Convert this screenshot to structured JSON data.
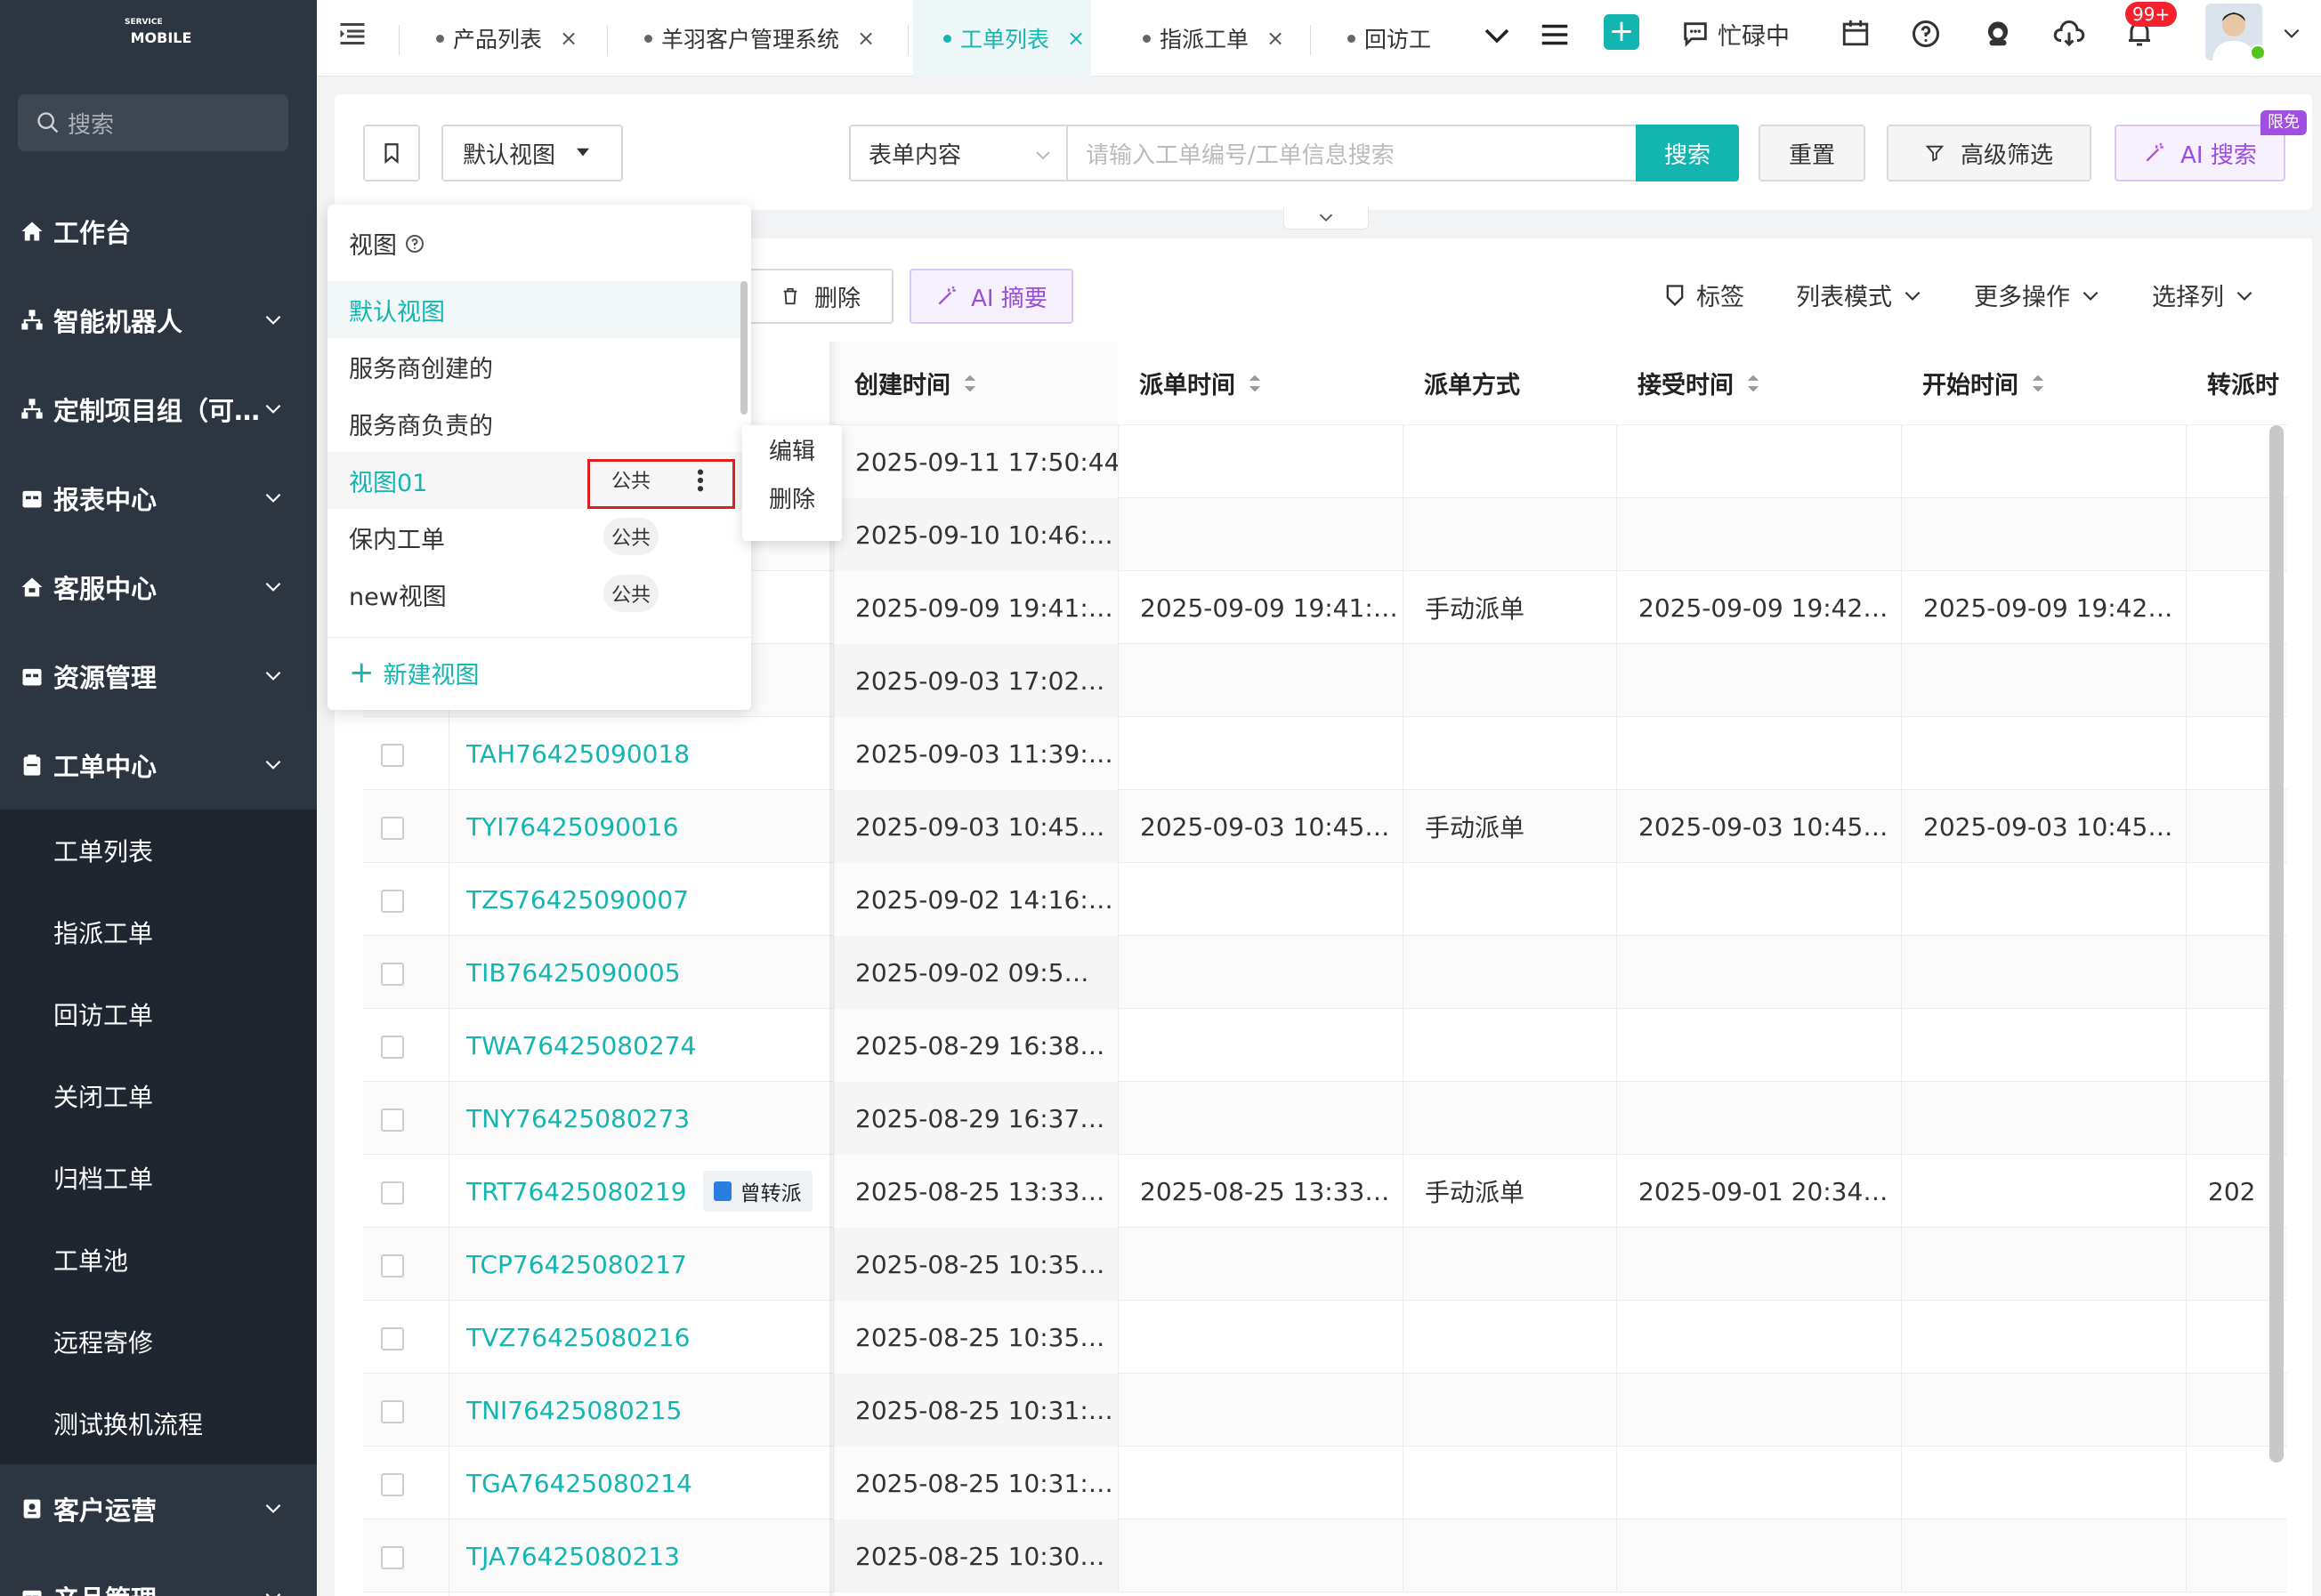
{
  "logo": {
    "small": "SERVICE",
    "big": "MOBILE"
  },
  "sidebar": {
    "search_placeholder": "搜索",
    "items": [
      {
        "label": "工作台"
      },
      {
        "label": "智能机器人"
      },
      {
        "label": "定制项目组（可…"
      },
      {
        "label": "报表中心"
      },
      {
        "label": "客服中心"
      },
      {
        "label": "资源管理"
      },
      {
        "label": "工单中心"
      }
    ],
    "sub_items": [
      "工单列表",
      "指派工单",
      "回访工单",
      "关闭工单",
      "归档工单",
      "工单池",
      "远程寄修",
      "测试换机流程"
    ],
    "bottom_items": [
      {
        "label": "客户运营"
      },
      {
        "label": "产品管理"
      }
    ]
  },
  "tabs": [
    {
      "label": "产品列表"
    },
    {
      "label": "羊羽客户管理系统"
    },
    {
      "label": "工单列表"
    },
    {
      "label": "指派工单"
    },
    {
      "label": "回访工"
    }
  ],
  "header": {
    "status": "忙碌中",
    "notif_badge": "99+"
  },
  "toolbar": {
    "view_select": "默认视图",
    "search_type": "表单内容",
    "search_placeholder": "请输入工单编号/工单信息搜索",
    "search_btn": "搜索",
    "reset_btn": "重置",
    "advanced_btn": "高级筛选",
    "ai_search_btn": "AI 搜索",
    "ai_tag": "限免"
  },
  "actions": {
    "delete_btn": "删除",
    "ai_summary_btn": "AI 摘要",
    "tag_btn": "标签",
    "list_mode": "列表模式",
    "more_ops": "更多操作",
    "select_cols": "选择列"
  },
  "columns": [
    "创建时间",
    "派单时间",
    "派单方式",
    "接受时间",
    "开始时间",
    "转派时"
  ],
  "rows": [
    {
      "id": "",
      "created": "2025-09-11 17:50:44",
      "dispatch": "",
      "method": "",
      "accept": "",
      "start": "",
      "transfer": ""
    },
    {
      "id": "",
      "created": "2025-09-10 10:46:…",
      "dispatch": "",
      "method": "",
      "accept": "",
      "start": "",
      "transfer": ""
    },
    {
      "id": "",
      "created": "2025-09-09 19:41:…",
      "dispatch": "2025-09-09 19:41:…",
      "method": "手动派单",
      "accept": "2025-09-09 19:42…",
      "start": "2025-09-09 19:42…",
      "transfer": ""
    },
    {
      "id": "",
      "created": "2025-09-03 17:02…",
      "dispatch": "",
      "method": "",
      "accept": "",
      "start": "",
      "transfer": ""
    },
    {
      "id": "TAH76425090018",
      "created": "2025-09-03 11:39:…",
      "dispatch": "",
      "method": "",
      "accept": "",
      "start": "",
      "transfer": ""
    },
    {
      "id": "TYI76425090016",
      "created": "2025-09-03 10:45…",
      "dispatch": "2025-09-03 10:45…",
      "method": "手动派单",
      "accept": "2025-09-03 10:45…",
      "start": "2025-09-03 10:45…",
      "transfer": ""
    },
    {
      "id": "TZS76425090007",
      "created": "2025-09-02 14:16:…",
      "dispatch": "",
      "method": "",
      "accept": "",
      "start": "",
      "transfer": ""
    },
    {
      "id": "TIB76425090005",
      "created": "2025-09-02 09:5…",
      "dispatch": "",
      "method": "",
      "accept": "",
      "start": "",
      "transfer": ""
    },
    {
      "id": "TWA76425080274",
      "created": "2025-08-29 16:38…",
      "dispatch": "",
      "method": "",
      "accept": "",
      "start": "",
      "transfer": ""
    },
    {
      "id": "TNY76425080273",
      "created": "2025-08-29 16:37…",
      "dispatch": "",
      "method": "",
      "accept": "",
      "start": "",
      "transfer": ""
    },
    {
      "id": "TRT76425080219",
      "tag": "曾转派",
      "created": "2025-08-25 13:33…",
      "dispatch": "2025-08-25 13:33…",
      "method": "手动派单",
      "accept": "2025-09-01 20:34…",
      "start": "",
      "transfer": "202"
    },
    {
      "id": "TCP76425080217",
      "created": "2025-08-25 10:35…",
      "dispatch": "",
      "method": "",
      "accept": "",
      "start": "",
      "transfer": ""
    },
    {
      "id": "TVZ76425080216",
      "created": "2025-08-25 10:35…",
      "dispatch": "",
      "method": "",
      "accept": "",
      "start": "",
      "transfer": ""
    },
    {
      "id": "TNI76425080215",
      "created": "2025-08-25 10:31:…",
      "dispatch": "",
      "method": "",
      "accept": "",
      "start": "",
      "transfer": ""
    },
    {
      "id": "TGA76425080214",
      "created": "2025-08-25 10:31:…",
      "dispatch": "",
      "method": "",
      "accept": "",
      "start": "",
      "transfer": ""
    },
    {
      "id": "TJA76425080213",
      "created": "2025-08-25 10:30…",
      "dispatch": "",
      "method": "",
      "accept": "",
      "start": "",
      "transfer": ""
    }
  ],
  "view_dropdown": {
    "title": "视图",
    "items": [
      {
        "label": "默认视图",
        "badge": ""
      },
      {
        "label": "服务商创建的",
        "badge": ""
      },
      {
        "label": "服务商负责的",
        "badge": ""
      },
      {
        "label": "视图01",
        "badge": "公共"
      },
      {
        "label": "保内工单",
        "badge": "公共"
      },
      {
        "label": "new视图",
        "badge": "公共"
      }
    ],
    "new_view": "新建视图"
  },
  "context_menu": {
    "edit": "编辑",
    "delete": "删除"
  },
  "colors": {
    "accent": "#13b5b1",
    "sidebar": "#2d3540",
    "highlight_border": "#e02020"
  }
}
